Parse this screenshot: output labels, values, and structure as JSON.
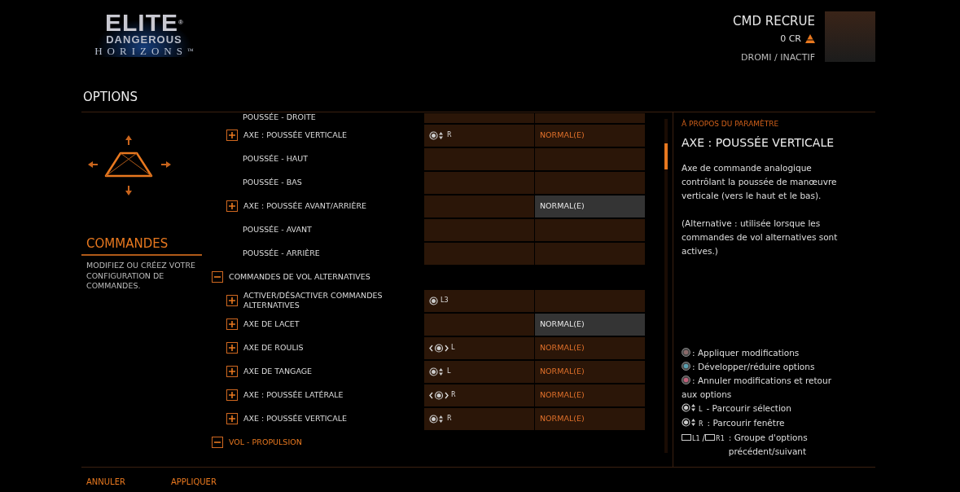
{
  "logo": {
    "line_1": "ELITE",
    "mark_1": "®",
    "line_2": "DANGEROUS",
    "line_3": "HORIZONS",
    "mark_3": "™"
  },
  "commander": {
    "name": "CMD RECRUE",
    "credits": "0 CR",
    "status": "DROMI / INACTIF"
  },
  "page_title": "OPTIONS",
  "section": {
    "title": "COMMANDES",
    "description": "MODIFIEZ OU CRÉEZ VOTRE CONFIGURATION DE COMMANDES."
  },
  "rows": [
    {
      "kind": "cut",
      "label": "POUSSÉE - DROITE"
    },
    {
      "kind": "axis",
      "label": "AXE : POUSSÉE VERTICALE",
      "binding": {
        "kind": "vertical",
        "label": "R"
      },
      "mode": "NORMAL(E)",
      "highlighted": false
    },
    {
      "kind": "sub",
      "label": "POUSSÉE - HAUT"
    },
    {
      "kind": "sub",
      "label": "POUSSÉE - BAS"
    },
    {
      "kind": "axis",
      "label": "AXE : POUSSÉE AVANT/ARRIÈRE",
      "mode": "NORMAL(E)",
      "highlighted": true
    },
    {
      "kind": "sub",
      "label": "POUSSÉE - AVANT"
    },
    {
      "kind": "sub",
      "label": "POUSSÉE - ARRIÈRE"
    },
    {
      "kind": "group",
      "label": "COMMANDES DE VOL ALTERNATIVES",
      "expanded": true,
      "active": false
    },
    {
      "kind": "axis",
      "label": "ACTIVER/DÉSACTIVER COMMANDES ALTERNATIVES",
      "binding": {
        "kind": "press",
        "label": "L3"
      },
      "highlighted": false
    },
    {
      "kind": "axis",
      "label": "AXE DE LACET",
      "mode": "NORMAL(E)",
      "highlighted": true
    },
    {
      "kind": "axis",
      "label": "AXE DE ROULIS",
      "binding": {
        "kind": "horizontal",
        "label": "L"
      },
      "mode": "NORMAL(E)",
      "highlighted": false
    },
    {
      "kind": "axis",
      "label": "AXE DE TANGAGE",
      "binding": {
        "kind": "vertical",
        "label": "L"
      },
      "mode": "NORMAL(E)",
      "highlighted": false
    },
    {
      "kind": "axis",
      "label": "AXE : POUSSÉE LATÉRALE",
      "binding": {
        "kind": "horizontal",
        "label": "R"
      },
      "mode": "NORMAL(E)",
      "highlighted": false
    },
    {
      "kind": "axis",
      "label": "AXE : POUSSÉE VERTICALE",
      "binding": {
        "kind": "vertical",
        "label": "R"
      },
      "mode": "NORMAL(E)",
      "highlighted": false
    },
    {
      "kind": "group",
      "label": "VOL - PROPULSION",
      "expanded": true,
      "active": true
    }
  ],
  "about": {
    "heading": "À PROPOS DU PARAMÈTRE",
    "title": "AXE : POUSSÉE VERTICALE",
    "paragraphs": [
      "Axe de commande analogique contrôlant la poussée de manœuvre verticale (vers le haut et le bas).",
      "(Alternative : utilisée lorsque les commandes de vol alternatives sont actives.)"
    ]
  },
  "legend": [
    {
      "kind": "button",
      "color": "#8a6a6a",
      "text": ": Appliquer modifications"
    },
    {
      "kind": "button",
      "color": "#5aa0b0",
      "text": ": Développer/réduire options"
    },
    {
      "kind": "button",
      "color": "#c0607a",
      "text": ": Annuler modifications et retour aux options"
    },
    {
      "kind": "stick",
      "label": "L",
      "text": "- Parcourir sélection"
    },
    {
      "kind": "stick",
      "label": "R",
      "text": ": Parcourir fenêtre"
    },
    {
      "kind": "bumpers",
      "label": "L1",
      "label_2": "R1",
      "separator": "/",
      "text": ": Groupe d'options précédent/suivant"
    }
  ],
  "footer": [
    "ANNULER",
    "APPLIQUER"
  ]
}
